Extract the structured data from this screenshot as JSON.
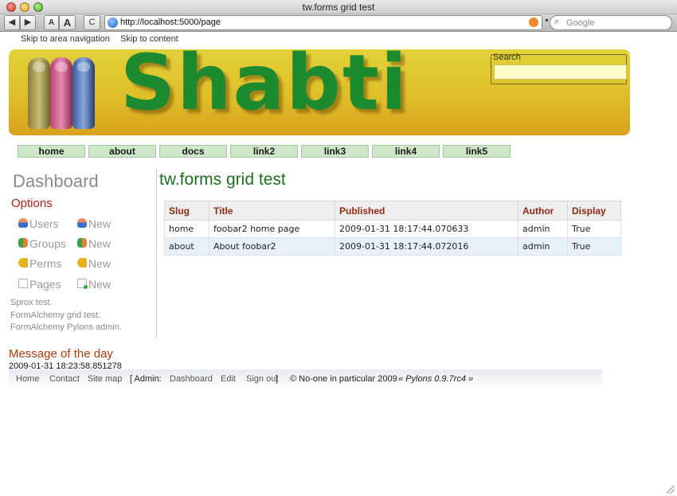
{
  "browser": {
    "window_title": "tw.forms grid test",
    "url": "http://localhost:5000/page",
    "search_placeholder": "Google",
    "buttons": {
      "back": "◀",
      "forward": "▶",
      "text_smaller": "A",
      "text_bigger": "A",
      "reload": "C"
    }
  },
  "skip_links": [
    "Skip to area navigation",
    "Skip to content"
  ],
  "banner": {
    "logo": "Shabti",
    "search_label": "Search",
    "search_value": ""
  },
  "nav": [
    "home",
    "about",
    "docs",
    "link2",
    "link3",
    "link4",
    "link5"
  ],
  "sidebar": {
    "title": "Dashboard",
    "options_title": "Options",
    "rows": [
      {
        "label": "Users",
        "icon": "user-icon",
        "new": "New"
      },
      {
        "label": "Groups",
        "icon": "group-icon",
        "new": "New"
      },
      {
        "label": "Perms",
        "icon": "key-icon",
        "new": "New"
      },
      {
        "label": "Pages",
        "icon": "page-icon",
        "new": "New"
      }
    ],
    "links": [
      "Sprox test",
      "FormAlchemy grid test",
      "FormAlchemy Pylons admin"
    ]
  },
  "main": {
    "title": "tw.forms grid test",
    "columns": [
      "Slug",
      "Title",
      "Published",
      "Author",
      "Display"
    ],
    "rows": [
      [
        "home",
        "foobar2 home page",
        "2009-01-31 18:17:44.070633",
        "admin",
        "True"
      ],
      [
        "about",
        "About foobar2",
        "2009-01-31 18:17:44.072016",
        "admin",
        "True"
      ]
    ]
  },
  "motd": {
    "title": "Message of the day",
    "timestamp": "2009-01-31 18:23:58.851278"
  },
  "footer": {
    "links": [
      "Home",
      "Contact",
      "Site map"
    ],
    "admin_open": "[ Admin:",
    "admin_links": [
      "Dashboard",
      "Edit",
      "Sign out"
    ],
    "admin_close": "]",
    "copyright": "© No-one in particular 2009",
    "pylons": "« Pylons 0.9.7rc4 »"
  },
  "colors": {
    "nav_tab": "#cfe7c9",
    "link_red": "#b01e0e",
    "title_green": "#1e6e1e",
    "banner_gold": "#dfbe28"
  }
}
